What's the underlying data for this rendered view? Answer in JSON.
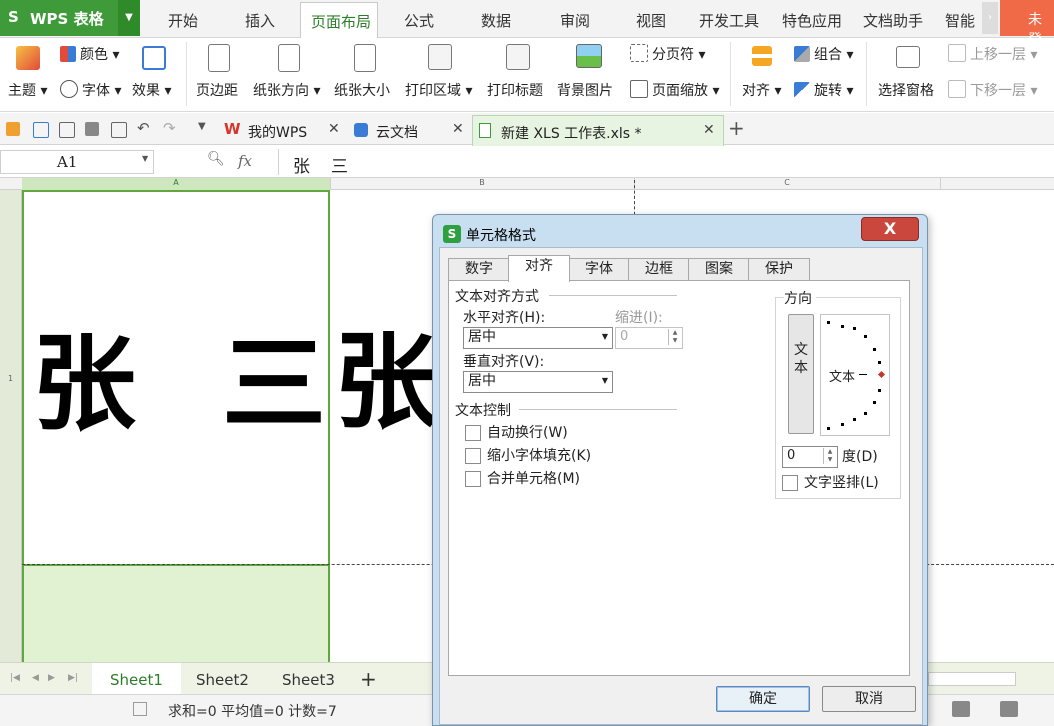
{
  "app": {
    "logo": "S",
    "name": "WPS 表格"
  },
  "menu": {
    "items": [
      "开始",
      "插入",
      "页面布局",
      "公式",
      "数据",
      "审阅",
      "视图",
      "开发工具",
      "特色应用",
      "文档助手",
      "智能"
    ],
    "active": "页面布局",
    "login": "未登"
  },
  "ribbon": {
    "theme": "主题",
    "colors": "颜色",
    "fonts": "字体",
    "effects": "效果",
    "margins": "页边距",
    "orientation": "纸张方向",
    "size": "纸张大小",
    "print_area": "打印区域",
    "print_titles": "打印标题",
    "background": "背景图片",
    "page_break": "分页符",
    "page_zoom": "页面缩放",
    "align": "对齐",
    "group": "组合",
    "rotate": "旋转",
    "selection_pane": "选择窗格",
    "bring_forward": "上移一层",
    "send_backward": "下移一层"
  },
  "doctabs": [
    {
      "label": "我的WPS"
    },
    {
      "label": "云文档"
    },
    {
      "label": "新建 XLS 工作表.xls *"
    }
  ],
  "formula": {
    "namebox": "A1",
    "fx": "fx",
    "content": "张　三"
  },
  "sheet": {
    "columns": [
      "A",
      "B",
      "C"
    ],
    "rows": [
      "1"
    ],
    "cell_a1_char1": "张",
    "cell_a1_char2": "三",
    "overflow_char": "张"
  },
  "sheets": {
    "tabs": [
      "Sheet1",
      "Sheet2",
      "Sheet3"
    ],
    "active": "Sheet1",
    "add": "+"
  },
  "status": {
    "text": "求和=0  平均值=0  计数=7"
  },
  "dialog": {
    "icon": "S",
    "title": "单元格格式",
    "close": "X",
    "tabs": [
      "数字",
      "对齐",
      "字体",
      "边框",
      "图案",
      "保护"
    ],
    "active_tab": "对齐",
    "text_alignment": {
      "group_title": "文本对齐方式",
      "horizontal_label": "水平对齐(H):",
      "horizontal_value": "居中",
      "indent_label": "缩进(I):",
      "indent_value": "0",
      "vertical_label": "垂直对齐(V):",
      "vertical_value": "居中"
    },
    "text_control": {
      "group_title": "文本控制",
      "wrap": "自动换行(W)",
      "shrink": "缩小字体填充(K)",
      "merge": "合并单元格(M)",
      "wrap_checked": false,
      "shrink_checked": false,
      "merge_checked": false
    },
    "orientation": {
      "group_title": "方向",
      "vertical_text": "文本",
      "dial_text": "文本",
      "degrees_value": "0",
      "degrees_label": "度(D)",
      "vertical_layout_label": "文字竖排(L)",
      "vertical_layout_checked": false
    },
    "ok": "确定",
    "cancel": "取消"
  },
  "colors": {
    "brand_green": "#3f9b3a",
    "selection_border": "#5fa83c",
    "dialog_frame": "#c8dff2",
    "close_red": "#c9473d"
  }
}
